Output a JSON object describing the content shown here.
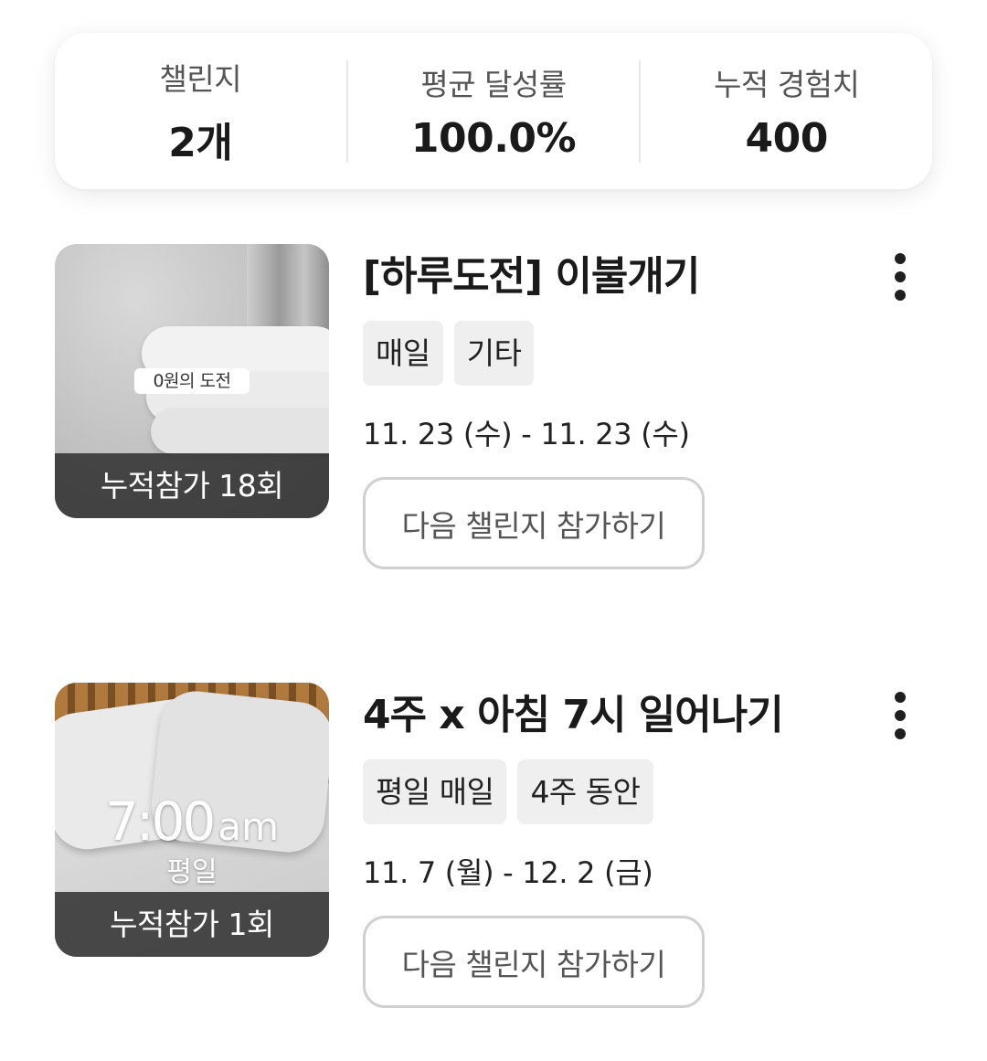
{
  "summary": {
    "challenges": {
      "label": "챌린지",
      "value": "2개"
    },
    "avg_rate": {
      "label": "평균 달성률",
      "value": "100.0%"
    },
    "exp": {
      "label": "누적 경험치",
      "value": "400"
    }
  },
  "challenges": [
    {
      "title": "[하루도전] 이불개기",
      "tags": [
        "매일",
        "기타"
      ],
      "dates": "11. 23 (수) - 11. 23 (수)",
      "button": "다음 챌린지 참가하기",
      "thumb_badge": "0원의 도전",
      "thumb_footer": "누적참가 18회",
      "more_icon": "more-vertical-icon"
    },
    {
      "title": "4주 x 아침 7시 일어나기",
      "tags": [
        "평일 매일",
        "4주 동안"
      ],
      "dates": "11. 7 (월) - 12. 2 (금)",
      "button": "다음 챌린지 참가하기",
      "thumb_time": "7:00",
      "thumb_ampm": "am",
      "thumb_sub": "평일",
      "thumb_footer": "누적참가 1회",
      "more_icon": "more-vertical-icon"
    }
  ]
}
